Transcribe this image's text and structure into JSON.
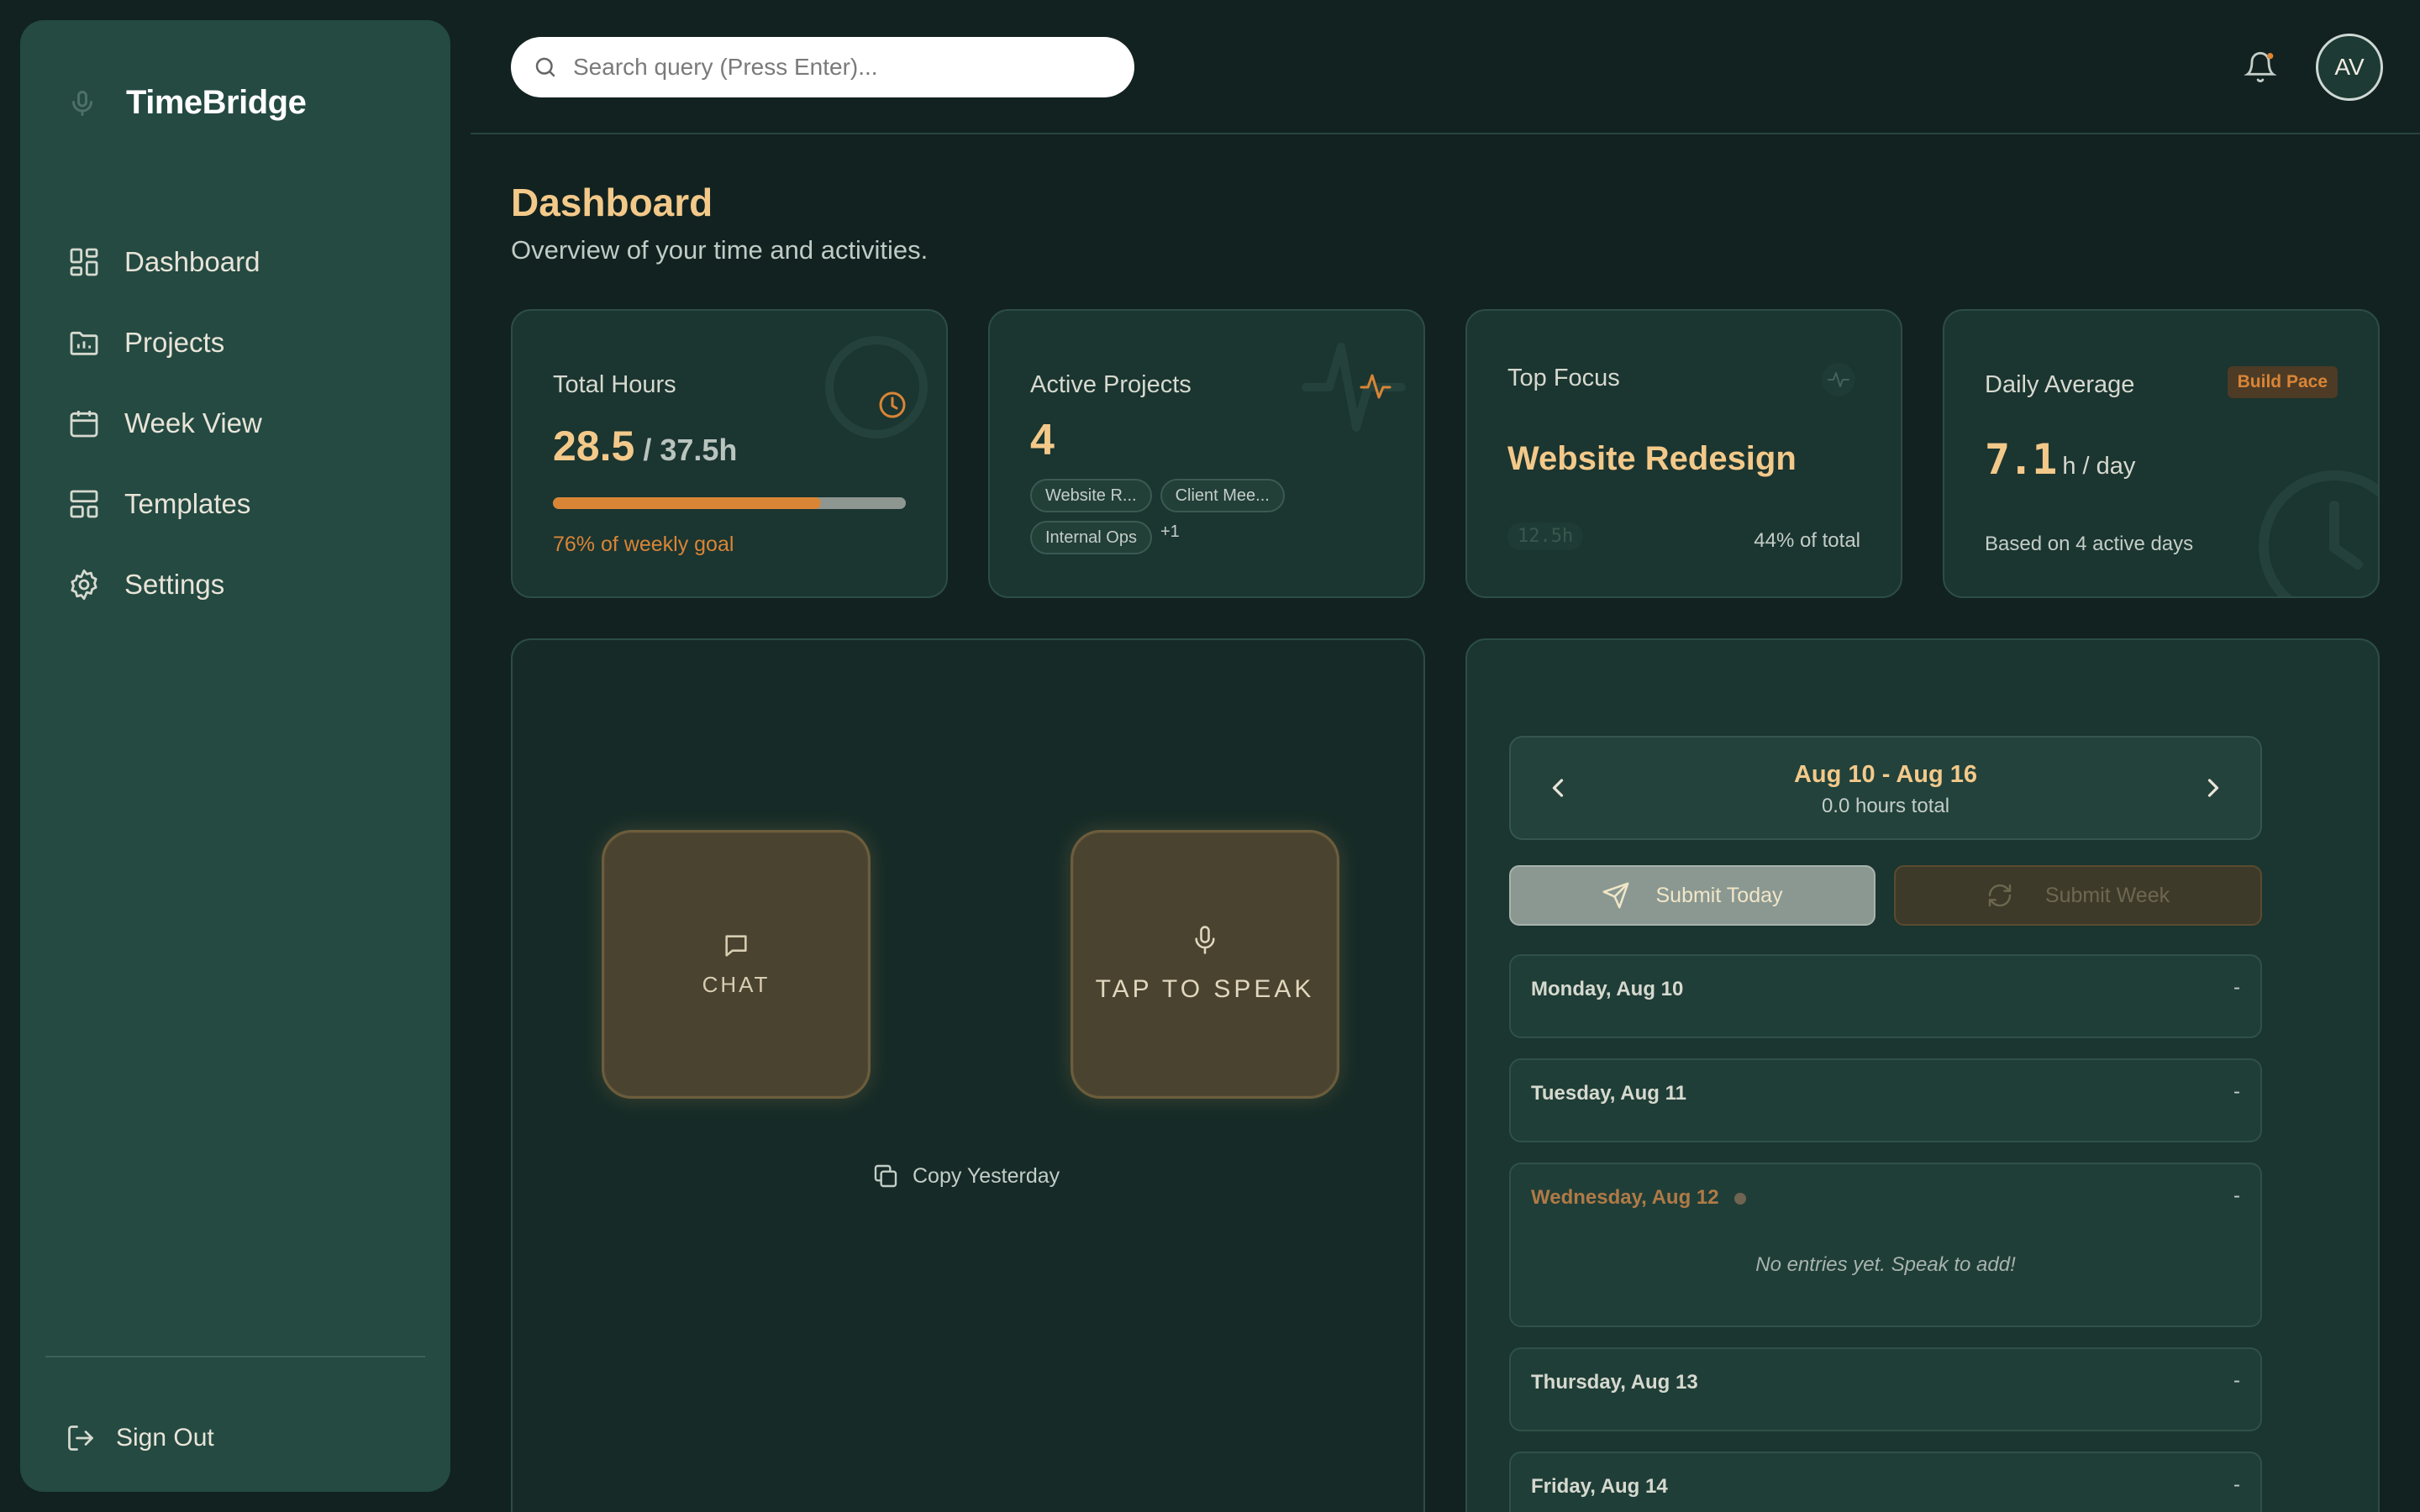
{
  "app": {
    "name": "TimeBridge"
  },
  "sidebar": {
    "items": [
      {
        "label": "Dashboard",
        "icon": "dashboard-icon"
      },
      {
        "label": "Projects",
        "icon": "projects-icon"
      },
      {
        "label": "Week View",
        "icon": "calendar-icon"
      },
      {
        "label": "Templates",
        "icon": "templates-icon"
      },
      {
        "label": "Settings",
        "icon": "gear-icon"
      }
    ],
    "sign_out": "Sign Out"
  },
  "header": {
    "search_placeholder": "Search query (Press Enter)...",
    "avatar_initials": "AV"
  },
  "page": {
    "title": "Dashboard",
    "subtitle": "Overview of your time and activities."
  },
  "stats": {
    "total_hours": {
      "label": "Total Hours",
      "value": "28.5",
      "target": " / 37.5h",
      "progress_pct": 76,
      "goal_text": "76% of weekly goal"
    },
    "active_projects": {
      "label": "Active Projects",
      "value": "4",
      "chips": [
        "Website R...",
        "Client Mee...",
        "Internal Ops"
      ],
      "more": "+1"
    },
    "top_focus": {
      "label": "Top Focus",
      "project": "Website Redesign",
      "hours": "12.5h",
      "share": "44% of total"
    },
    "daily_average": {
      "label": "Daily Average",
      "badge": "Build Pace",
      "value": "7.1",
      "unit": " h / day",
      "note": "Based on 4 active days"
    }
  },
  "actions": {
    "chat_label": "CHAT",
    "speak_label": "TAP TO SPEAK",
    "copy_yesterday": "Copy Yesterday"
  },
  "week": {
    "range": "Aug 10 - Aug 16",
    "total": "0.0 hours total",
    "submit_today": "Submit Today",
    "submit_week": "Submit Week",
    "days": [
      {
        "name": "Monday, Aug 10",
        "value": "-"
      },
      {
        "name": "Tuesday, Aug 11",
        "value": "-"
      },
      {
        "name": "Wednesday, Aug 12",
        "value": "-",
        "empty": "No entries yet. Speak to add!"
      },
      {
        "name": "Thursday, Aug 13",
        "value": "-"
      },
      {
        "name": "Friday, Aug 14",
        "value": "-"
      }
    ]
  },
  "colors": {
    "accent": "#f3c98a",
    "orange": "#d98536",
    "sidebar": "#244a42",
    "background": "#122220"
  }
}
